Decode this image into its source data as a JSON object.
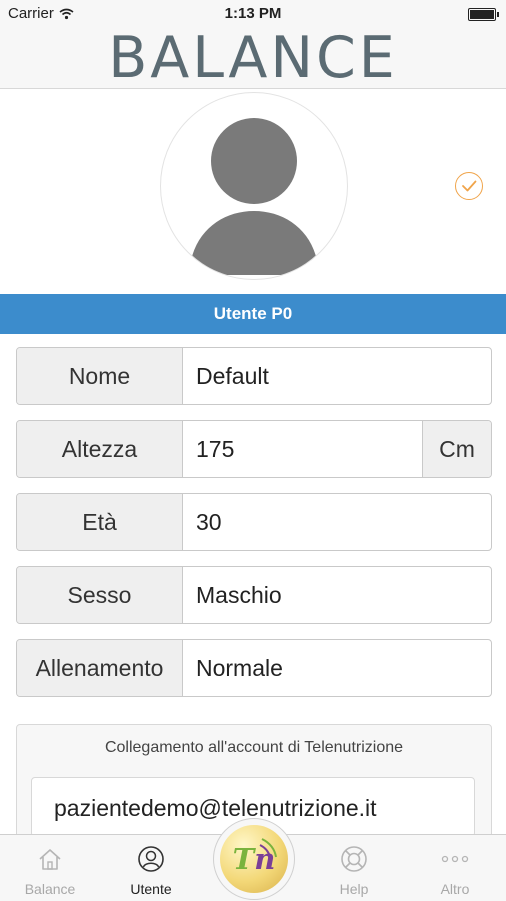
{
  "status_bar": {
    "carrier": "Carrier",
    "time": "1:13 PM"
  },
  "header": {
    "logo": "BALANCE"
  },
  "profile": {
    "title": "Utente P0"
  },
  "form": {
    "nome_label": "Nome",
    "nome_value": "Default",
    "altezza_label": "Altezza",
    "altezza_value": "175",
    "altezza_unit": "Cm",
    "eta_label": "Età",
    "eta_value": "30",
    "sesso_label": "Sesso",
    "sesso_value": "Maschio",
    "allenamento_label": "Allenamento",
    "allenamento_value": "Normale"
  },
  "account": {
    "label": "Collegamento all'account di Telenutrizione",
    "email": "pazientedemo@telenutrizione.it"
  },
  "tabbar": {
    "tabs": [
      {
        "label": "Balance",
        "icon": "home-icon"
      },
      {
        "label": "Utente",
        "icon": "user-icon",
        "active": true
      },
      {
        "label": "Help",
        "icon": "lifebuoy-icon"
      },
      {
        "label": "Altro",
        "icon": "more-icon"
      }
    ],
    "center": {
      "t": "T",
      "n": "n",
      "icon": "telenutrizione-logo-icon"
    }
  },
  "colors": {
    "accent": "#3c8ccc",
    "check": "#f0a44a",
    "logo": "#5b6b73"
  }
}
